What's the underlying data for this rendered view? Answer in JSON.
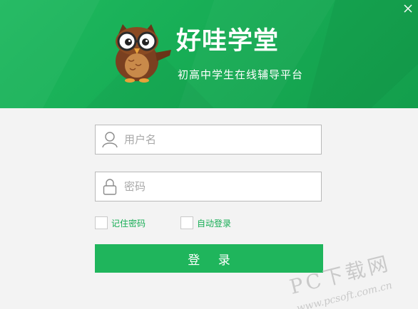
{
  "header": {
    "brand_title": "好哇学堂",
    "brand_subtitle": "初高中学生在线辅导平台",
    "close_icon": "close-icon",
    "colors": {
      "primary_green": "#17ad55",
      "header_light": "#1fb95f",
      "header_dark": "#139e4c"
    }
  },
  "form": {
    "username": {
      "placeholder": "用户名",
      "value": "",
      "icon": "user-icon"
    },
    "password": {
      "placeholder": "密码",
      "value": "",
      "icon": "lock-icon"
    },
    "remember_password": {
      "label": "记住密码",
      "checked": false
    },
    "auto_login": {
      "label": "自动登录",
      "checked": false
    },
    "login_label": "登 录"
  },
  "watermark": {
    "text_main": "PC下载网",
    "text_url": "www.pcsoft.com.cn"
  }
}
